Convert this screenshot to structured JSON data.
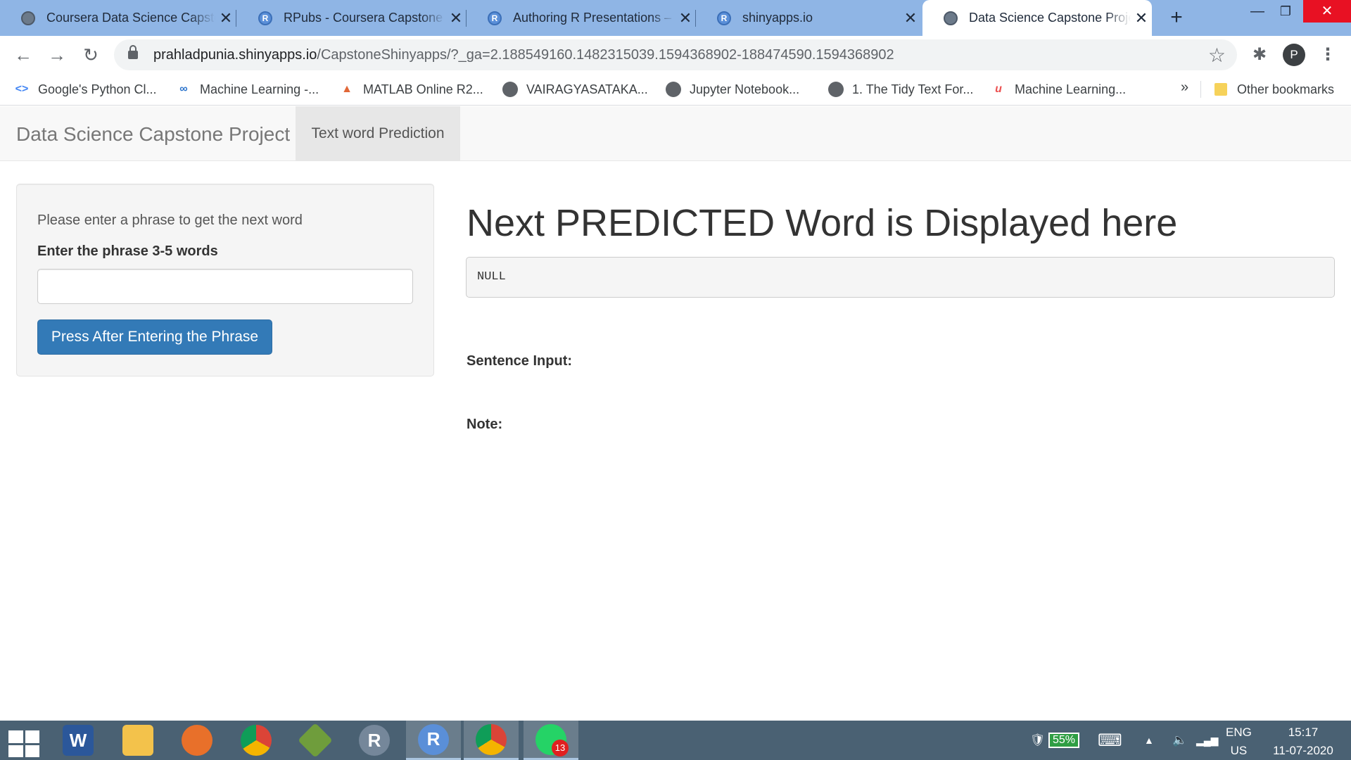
{
  "browser": {
    "tabs": [
      {
        "title": "Coursera Data Science Capstone",
        "icon": "globe-icon",
        "active": false
      },
      {
        "title": "RPubs - Coursera Capstone Project",
        "icon": "r-icon",
        "active": false
      },
      {
        "title": "Authoring R Presentations – RStudio",
        "icon": "r-icon",
        "active": false
      },
      {
        "title": "shinyapps.io",
        "icon": "r-icon",
        "active": false
      },
      {
        "title": "Data Science Capstone Project",
        "icon": "globe-icon",
        "active": true
      }
    ],
    "url_host": "prahladpunia.shinyapps.io",
    "url_path": "/CapstoneShinyapps/?_ga=2.188549160.1482315039.1594368902-188474590.1594368902",
    "profile_initial": "P",
    "bookmarks": [
      {
        "label": "Google's Python Cl...",
        "icon": "code-icon"
      },
      {
        "label": "Machine Learning -...",
        "icon": "coursera-icon"
      },
      {
        "label": "MATLAB Online R2...",
        "icon": "matlab-icon"
      },
      {
        "label": "VAIRAGYASATAKA...",
        "icon": "globe-icon"
      },
      {
        "label": "Jupyter Notebook...",
        "icon": "globe-icon"
      },
      {
        "label": "1. The Tidy Text For...",
        "icon": "globe-icon"
      },
      {
        "label": "Machine Learning...",
        "icon": "udemy-icon"
      }
    ],
    "more_bookmarks": "»",
    "other_bookmarks": "Other bookmarks"
  },
  "app": {
    "brand": "Data Science Capstone Project",
    "nav_tab": "Text word Prediction",
    "sidebar": {
      "help_text": "Please enter a phrase to get the next word",
      "input_label": "Enter the phrase 3-5 words",
      "input_value": "",
      "input_placeholder": "",
      "button_label": "Press After Entering the Phrase"
    },
    "main": {
      "heading": "Next PREDICTED Word is Displayed here",
      "prediction": "NULL",
      "sentence_label": "Sentence Input:",
      "note_label": "Note:"
    }
  },
  "taskbar": {
    "apps": [
      {
        "name": "word-icon",
        "glyph": "W",
        "color": "#2b579a",
        "running": false
      },
      {
        "name": "file-explorer-icon",
        "glyph": "",
        "color": "#f3c24b",
        "running": false
      },
      {
        "name": "sync-icon",
        "glyph": "",
        "color": "#e8702a",
        "running": false
      },
      {
        "name": "chrome-icon",
        "glyph": "",
        "color": "#db4437",
        "running": false
      },
      {
        "name": "app-icon",
        "glyph": "",
        "color": "#6f9d3c",
        "running": false
      },
      {
        "name": "rstudio-icon",
        "glyph": "R",
        "color": "#75879a",
        "running": false
      },
      {
        "name": "r-icon",
        "glyph": "R",
        "color": "#5a8fd8",
        "running": true
      },
      {
        "name": "chrome-icon",
        "glyph": "",
        "color": "#db4437",
        "running": true
      },
      {
        "name": "whatsapp-icon",
        "glyph": "",
        "color": "#25d366",
        "running": true
      }
    ],
    "whatsapp_badge": "13",
    "battery": "55%",
    "language_top": "ENG",
    "language_bottom": "US",
    "time": "15:17",
    "date": "11-07-2020"
  }
}
